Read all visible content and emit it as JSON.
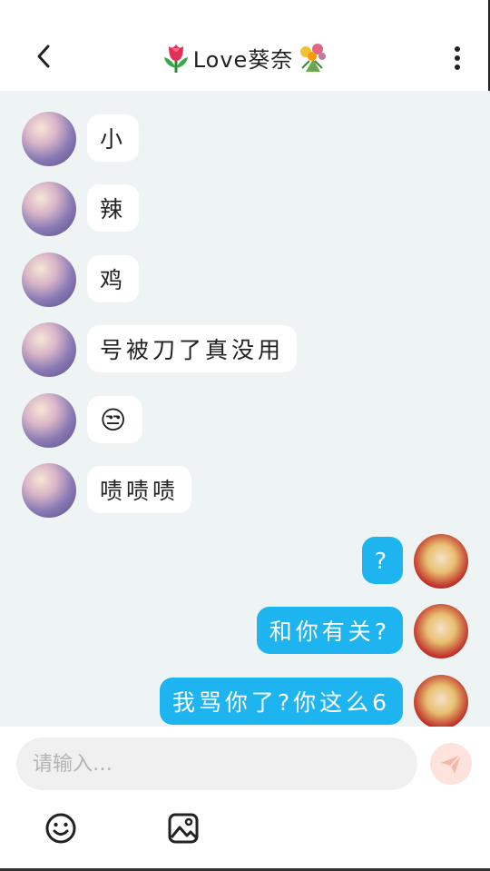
{
  "header": {
    "title": "Love葵奈",
    "title_prefix_icon": "tulip-emoji",
    "title_suffix_icon": "bouquet-emoji",
    "back_icon": "chevron-left-icon",
    "more_icon": "more-vertical-icon"
  },
  "messages": [
    {
      "side": "in",
      "text": "小"
    },
    {
      "side": "in",
      "text": "辣"
    },
    {
      "side": "in",
      "text": "鸡"
    },
    {
      "side": "in",
      "text": "号被刀了真没用"
    },
    {
      "side": "in",
      "text": "😒"
    },
    {
      "side": "in",
      "text": "啧啧啧"
    },
    {
      "side": "out",
      "text": "?"
    },
    {
      "side": "out",
      "text": "和你有关?"
    },
    {
      "side": "out",
      "text": "我骂你了?你这么6"
    }
  ],
  "composer": {
    "placeholder": "请输入…",
    "send_icon": "send-icon",
    "emoji_icon": "emoji-icon",
    "image_icon": "image-icon"
  },
  "colors": {
    "chat_bg": "#eef4f4",
    "outgoing_bubble": "#1eb4f0",
    "incoming_bubble": "#ffffff",
    "send_button": "#fde3dc"
  }
}
